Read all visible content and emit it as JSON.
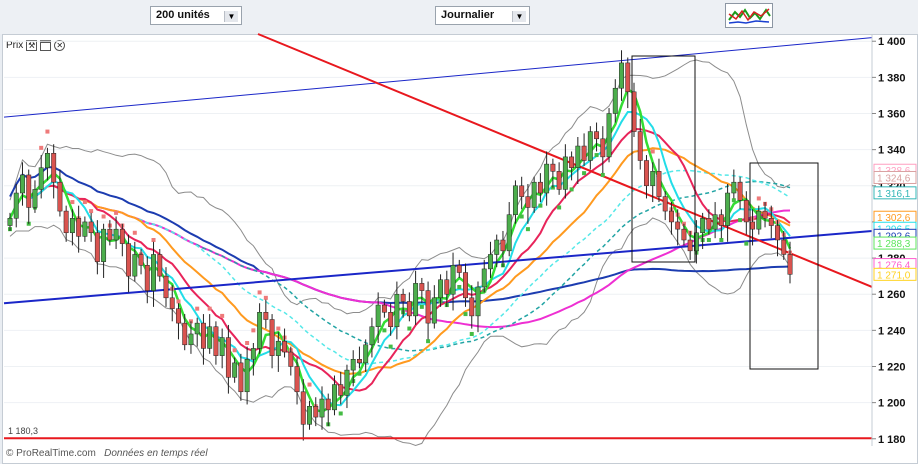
{
  "toolbar": {
    "units_select": "200 unités",
    "period_select": "Journalier",
    "indicator_icon": "chart-indicator-icon"
  },
  "panel": {
    "label": "Prix",
    "icons": [
      "wrench-icon",
      "window-icon",
      "close-icon"
    ]
  },
  "footer": {
    "copyright": "© ProRealTime.com",
    "note": "Données en temps réel"
  },
  "chart_data": {
    "type": "candlestick",
    "ylim": [
      1176,
      1404
    ],
    "y_ticks": [
      "1 400",
      "1 380",
      "1 360",
      "1 340",
      "1 320",
      "1 300",
      "1 280",
      "1 260",
      "1 240",
      "1 220",
      "1 200",
      "1 180"
    ],
    "support_line": {
      "value": 1180.3,
      "label": "1 180,3"
    },
    "price_labels": [
      {
        "value": 1328.6,
        "label": "1 328,6",
        "color": "#ff9fc0"
      },
      {
        "value": 1324.6,
        "label": "1 324,6",
        "color": "#d9a0a0"
      },
      {
        "value": 1316.1,
        "label": "1 316,1",
        "color": "#33b7b7"
      },
      {
        "value": 1302.6,
        "label": "1 302,6",
        "color": "#ff9a1f"
      },
      {
        "value": 1296.5,
        "label": "1 296,5",
        "color": "#22e0e8"
      },
      {
        "value": 1292.6,
        "label": "1 292,6",
        "color": "#1a3fb5"
      },
      {
        "value": 1288.3,
        "label": "1 288,3",
        "color": "#5ce65c"
      },
      {
        "value": 1276.4,
        "label": "1 276,4",
        "color": "#ff5fd0"
      },
      {
        "value": 1271.0,
        "label": "1 271,0",
        "color": "#ffd21f"
      }
    ],
    "candles": [
      1302,
      1316,
      1326,
      1308,
      1318,
      1330,
      1338,
      1322,
      1306,
      1294,
      1302,
      1292,
      1300,
      1294,
      1278,
      1296,
      1290,
      1296,
      1288,
      1270,
      1282,
      1276,
      1262,
      1282,
      1270,
      1258,
      1252,
      1244,
      1232,
      1238,
      1244,
      1230,
      1242,
      1226,
      1236,
      1214,
      1222,
      1206,
      1224,
      1230,
      1250,
      1246,
      1226,
      1234,
      1228,
      1220,
      1206,
      1188,
      1198,
      1192,
      1202,
      1196,
      1210,
      1204,
      1218,
      1224,
      1222,
      1232,
      1242,
      1254,
      1250,
      1242,
      1260,
      1256,
      1248,
      1266,
      1262,
      1244,
      1258,
      1268,
      1260,
      1276,
      1272,
      1258,
      1248,
      1264,
      1274,
      1282,
      1290,
      1284,
      1304,
      1320,
      1314,
      1308,
      1322,
      1316,
      1332,
      1328,
      1318,
      1336,
      1330,
      1342,
      1334,
      1350,
      1346,
      1336,
      1360,
      1374,
      1388,
      1372,
      1350,
      1334,
      1320,
      1328,
      1314,
      1306,
      1300,
      1296,
      1290,
      1284,
      1294,
      1302,
      1296,
      1304,
      1298,
      1316,
      1322,
      1312,
      1300,
      1296,
      1306,
      1302,
      1298,
      1290,
      1282,
      1271
    ],
    "series_colors": {
      "bollinger": "#8c8c8c",
      "ma_green": "#33dd33",
      "ma_cyan": "#22dde8",
      "ma_red": "#e8245a",
      "ma_orange": "#ff9a1f",
      "ma_magenta": "#ee2fd2",
      "ma_navy": "#1c3cb0",
      "ma_teal_dash": "#22a4a4",
      "ma_cyan_dash": "#55e8e8",
      "sar_pink": "#ee7a7a",
      "sar_green": "#44bb44",
      "trend_red": "#e8181e",
      "trend_blue": "#1a26c8"
    }
  }
}
